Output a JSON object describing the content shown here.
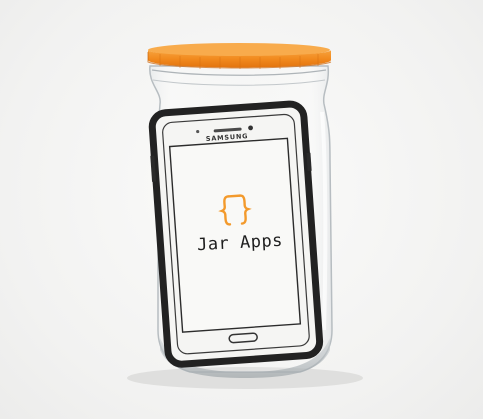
{
  "scene": {
    "phone_brand": "SAMSUNG",
    "app_name": "Jar Apps",
    "logo_icon": "braces-jar-icon"
  },
  "colors": {
    "lid": "#f28a1e",
    "logo": "#f39a2c",
    "background": "#f4f4f3",
    "phone_frame": "#222222",
    "screen": "#f7f7f5"
  }
}
